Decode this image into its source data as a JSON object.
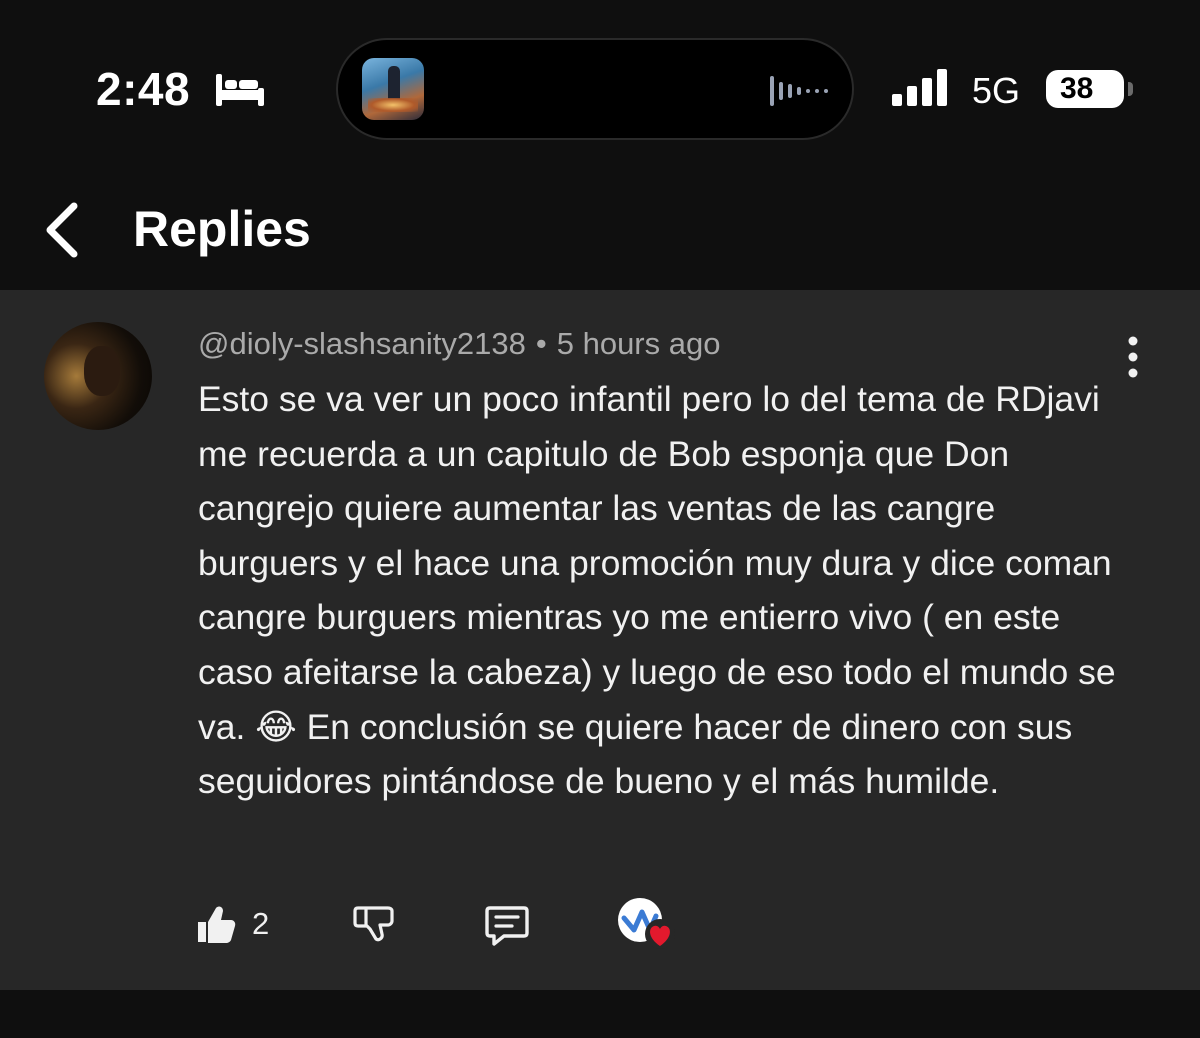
{
  "status_bar": {
    "time": "2:48",
    "network": "5G",
    "battery": "38",
    "icons": [
      "bed-icon",
      "audio-waveform-icon",
      "signal-bars-icon"
    ]
  },
  "header": {
    "title": "Replies",
    "back_icon": "chevron-left-icon"
  },
  "comment": {
    "author": "@dioly-slashsanity2138",
    "separator": "•",
    "time_ago": "5 hours ago",
    "text": "Esto se va ver un poco infantil pero lo del tema de RDjavi me recuerda a un capitulo de Bob esponja que Don cangrejo quiere aumentar las ventas de las cangre burguers y el hace una promoción muy dura y dice coman cangre burguers mientras yo me entierro vivo ( en este caso afeitarse la cabeza) y luego de eso todo el mundo se va. 😂 En conclusión se quiere hacer de dinero con sus seguidores pintándose de bueno y el más humilde.",
    "likes": "2",
    "action_icons": [
      "thumbs-up-icon",
      "thumbs-down-icon",
      "reply-icon",
      "creator-heart-icon"
    ]
  },
  "colors": {
    "background": "#0f0f0f",
    "card": "#272727",
    "meta_text": "#aaaaaa",
    "primary_text": "#f1f1f1",
    "heart": "#e3192d"
  }
}
